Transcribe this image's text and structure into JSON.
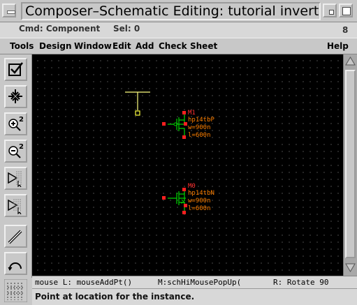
{
  "window": {
    "title": "Composer–Schematic Editing: tutorial inverter sche",
    "minimize_icon": "minimize-icon",
    "maximize_icon": "maximize-icon"
  },
  "status": {
    "cmd": "Cmd: Component",
    "sel": "Sel: 0",
    "number": "8"
  },
  "menubar": {
    "items": [
      "Tools",
      "Design",
      "Window",
      "Edit",
      "Add",
      "Check",
      "Sheet",
      "Help"
    ]
  },
  "toolbar": {
    "tools": [
      {
        "name": "check-save-icon"
      },
      {
        "name": "fit-icon"
      },
      {
        "name": "zoom-in-icon",
        "label": "2"
      },
      {
        "name": "zoom-out-icon",
        "label": "2"
      },
      {
        "name": "stretch-icon"
      },
      {
        "name": "copy-icon"
      },
      {
        "name": "wire-icon"
      },
      {
        "name": "undo-icon"
      },
      {
        "name": "grid-icon"
      }
    ]
  },
  "schematic": {
    "pmos": {
      "name": "M1",
      "model": "hp14tbP",
      "w": "w=900n",
      "l": "l=600n"
    },
    "nmos": {
      "name": "M0",
      "model": "hp14tbN",
      "w": "w=900n",
      "l": "l=600n"
    },
    "colors": {
      "wire": "#00d000",
      "pin": "#ff2020",
      "label": "#ff8000",
      "instname": "#ff3030",
      "vdd": "#ffff80"
    }
  },
  "mouse": {
    "left": "mouse L: mouseAddPt()",
    "middle": "M:schHiMousePopUp(",
    "right": "R: Rotate 90"
  },
  "prompt": "Point at location for the instance."
}
